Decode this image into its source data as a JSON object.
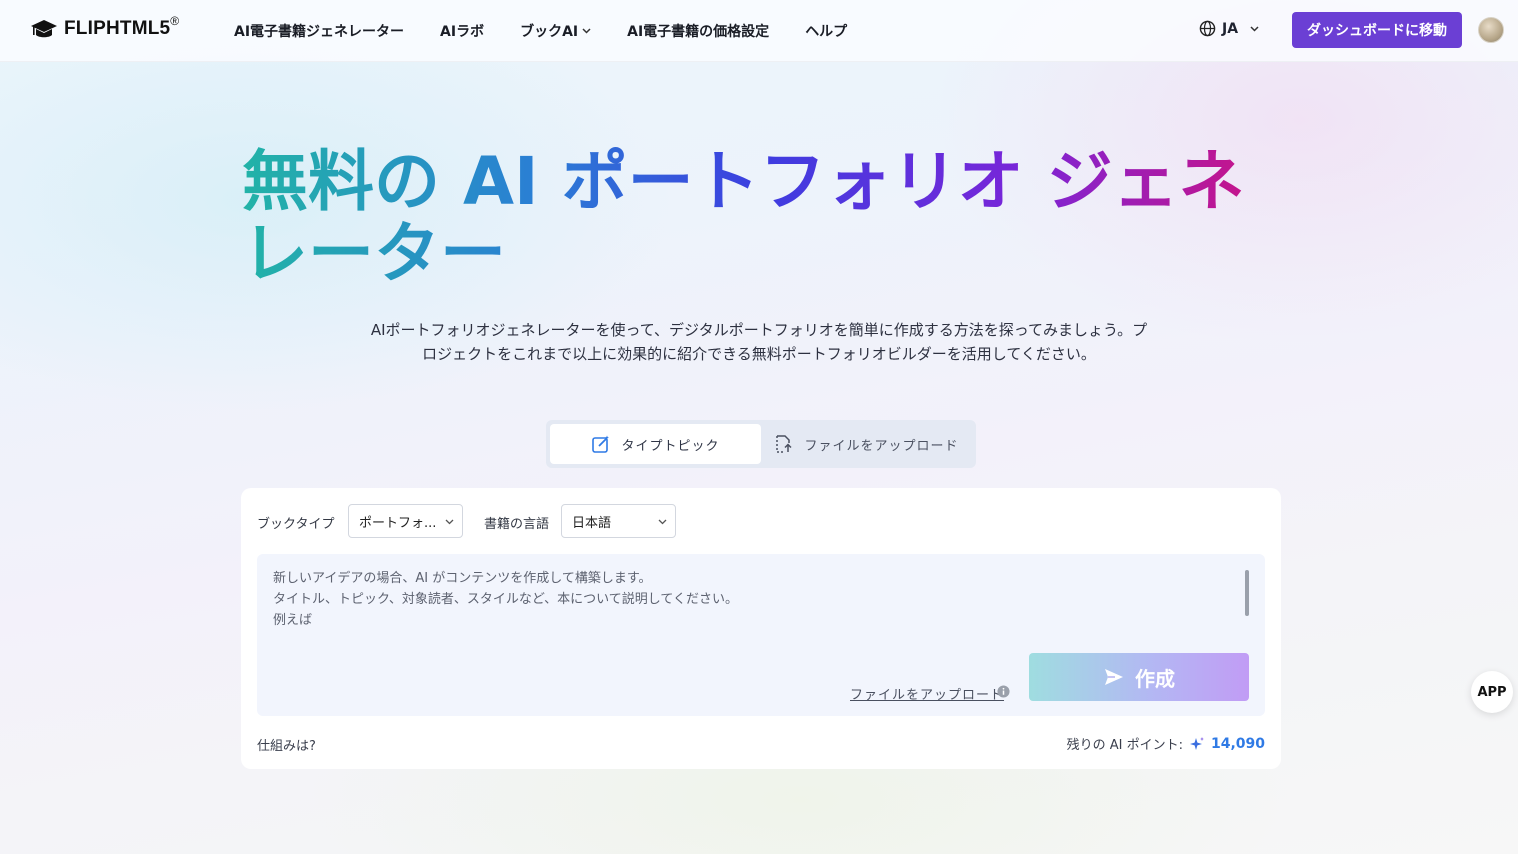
{
  "header": {
    "logo_text": "FLIPHTML5",
    "logo_reg": "®",
    "nav": [
      {
        "label": "AI電子書籍ジェネレーター"
      },
      {
        "label": "AIラボ"
      },
      {
        "label": "ブックAI"
      },
      {
        "label": "AI電子書籍の価格設定"
      },
      {
        "label": "ヘルプ"
      }
    ],
    "language": "JA",
    "dashboard_button": "ダッシュボードに移動"
  },
  "hero": {
    "title_line1": "無料の AI ポートフォリオ ジェネ",
    "title_line2": "レーター",
    "subtitle": "AIポートフォリオジェネレーターを使って、デジタルポートフォリオを簡単に作成する方法を探ってみましょう。プロジェクトをこれまで以上に効果的に紹介できる無料ポートフォリオビルダーを活用してください。"
  },
  "tabs": [
    {
      "label": "タイプトピック",
      "icon": "edit-icon",
      "active": true
    },
    {
      "label": "ファイルをアップロード",
      "icon": "file-upload-icon",
      "active": false
    }
  ],
  "form": {
    "book_type_label": "ブックタイプ",
    "book_type_value": "ポートフォ...",
    "language_label": "書籍の言語",
    "language_value": "日本語",
    "prompt_placeholder": "新しいアイデアの場合、AI がコンテンツを作成して構築します。\nタイトル、トピック、対象読者、スタイルなど、本について説明してください。\n例えば",
    "upload_link": "ファイルをアップロード",
    "create_button": "作成",
    "how_it_works": "仕組みは?",
    "points_label": "残りの AI ポイント:",
    "points_value": "14,090"
  },
  "float": {
    "app_label": "APP"
  },
  "colors": {
    "primary": "#6b3fd4",
    "points_blue": "#2f7ae5"
  }
}
